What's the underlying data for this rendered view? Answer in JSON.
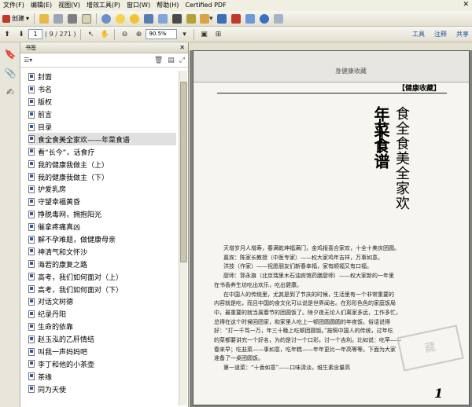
{
  "menu": {
    "items": [
      "文件(F)",
      "编辑(E)",
      "视图(V)",
      "增效工具(P)",
      "窗口(W)",
      "帮助(H)",
      "Certified PDF"
    ],
    "close_glyph": "✕"
  },
  "toolbar1": {
    "create_label": "创建"
  },
  "toolbar2": {
    "page_current": "1",
    "page_total": "( 9 / 271 )",
    "zoom": "90.5%",
    "links": [
      "工具",
      "注释",
      "共享"
    ]
  },
  "bookmarks": {
    "header": "书签",
    "close_glyph": "✕",
    "options_glyph": "☰▾",
    "items": [
      "封面",
      "书名",
      "版权",
      "前言",
      "目录",
      "食全食美全家欢——年菜食谱",
      "看“长今”，话食疗",
      "我的健康我做主（上）",
      "我的健康我做主（下）",
      "护爱乳房",
      "守望幸福黄昏",
      "挣脱毒网，拥抱阳光",
      "催拿疼痛真凶",
      "解不孕难题，做健康母亲",
      "神清气和文怀沙",
      "海若的康复之路",
      "高考，我们如何面对（上）",
      "高考，我们如何面对（下）",
      "对话文树德",
      "纪录丹阳",
      "生命的依靠",
      "赵玉泓的乙肝情结",
      "叫我一声妈妈吧",
      "李丁和他的小茶壶",
      "茶缘",
      "同为天使"
    ],
    "selected_index": 5
  },
  "document": {
    "prev_page_text": "身健康收藏",
    "header": "【健康收藏】",
    "title_line1": "食全食美全家欢",
    "title_line2": "年菜食谱",
    "paragraphs": [
      "天增岁月人增寿，春满乾坤福满门，金鸡报喜合家欢，十全十美庆团圆。",
      "嘉宾：陈家长教授（中医专家）——权大家鸡年吉祥，万事如意。",
      "洪技（作家）——祝愿朋友们新春幸福，家有顺福又有口福。",
      "厨师：郭永旗（北京瑞里木石油宾馆药膳厨师）——权大家新的一年里",
      "在书香养生坊吃出欢乐，吃出健康。",
      "在中国人的传统里，尤其是到了节庆的时候，生活里有一个非常重要的",
      "内容就是吃，而且中国的食文化可以说是世界闻名。在形形色色的家庭饭局",
      "中，最重要的就当属春节的团圆饭了。除夕夜无论人们离家多远，工作多忙，",
      "总得在这个时候回团家，和家里人吃上一顿团圆圆圆的年夜饭。俗话说得",
      "好：“打一千骂一万，年三十晚上吃顿团圆饭。”按照中国人的传统，过年吃",
      "的菜都要讲究一个好名，为的是讨一个口彩，讨一个吉利。比如说：吃苹——",
      "春来早；吃韭菜——事如意，吃年糕——年年更比一年高等等。下面为大家",
      "准备了一桌团圆饭。",
      "第一道菜：“十香如意”——口味清淡，维生素含量高"
    ],
    "indent_flags": [
      true,
      true,
      true,
      true,
      false,
      true,
      false,
      false,
      false,
      false,
      false,
      false,
      false,
      true
    ],
    "page_number": "1",
    "stamp_text": "藏"
  }
}
